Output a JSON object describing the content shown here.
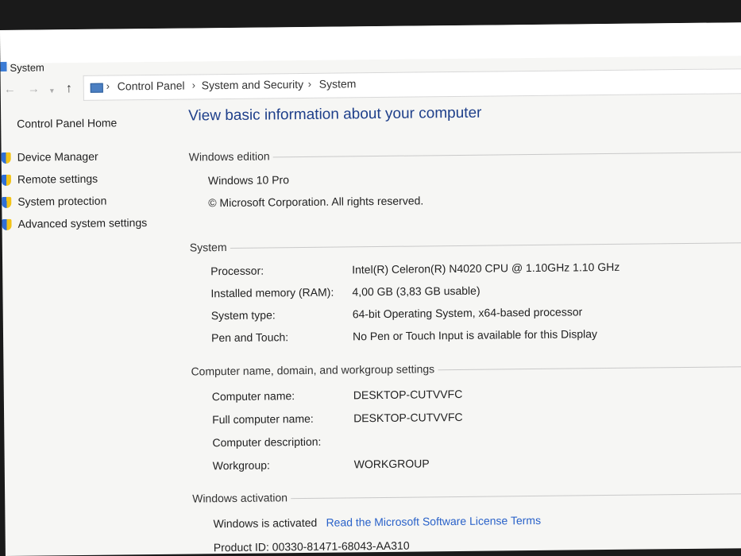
{
  "window": {
    "title": "System"
  },
  "breadcrumb": [
    "Control Panel",
    "System and Security",
    "System"
  ],
  "sidebar": {
    "home": "Control Panel Home",
    "items": [
      "Device Manager",
      "Remote settings",
      "System protection",
      "Advanced system settings"
    ]
  },
  "main": {
    "heading": "View basic information about your computer",
    "edition": {
      "title": "Windows edition",
      "name": "Windows 10 Pro",
      "copyright": "© Microsoft Corporation. All rights reserved."
    },
    "system": {
      "title": "System",
      "rows": [
        {
          "label": "Processor:",
          "value": "Intel(R) Celeron(R) N4020 CPU @ 1.10GHz   1.10 GHz"
        },
        {
          "label": "Installed memory (RAM):",
          "value": "4,00 GB (3,83 GB usable)"
        },
        {
          "label": "System type:",
          "value": "64-bit Operating System, x64-based processor"
        },
        {
          "label": "Pen and Touch:",
          "value": "No Pen or Touch Input is available for this Display"
        }
      ]
    },
    "computer": {
      "title": "Computer name, domain, and workgroup settings",
      "rows": [
        {
          "label": "Computer name:",
          "value": "DESKTOP-CUTVVFC"
        },
        {
          "label": "Full computer name:",
          "value": "DESKTOP-CUTVVFC"
        },
        {
          "label": "Computer description:",
          "value": ""
        },
        {
          "label": "Workgroup:",
          "value": "WORKGROUP"
        }
      ]
    },
    "activation": {
      "title": "Windows activation",
      "status": "Windows is activated",
      "license_link": "Read the Microsoft Software License Terms",
      "product_id": "Product ID: 00330-81471-68043-AA310"
    }
  }
}
